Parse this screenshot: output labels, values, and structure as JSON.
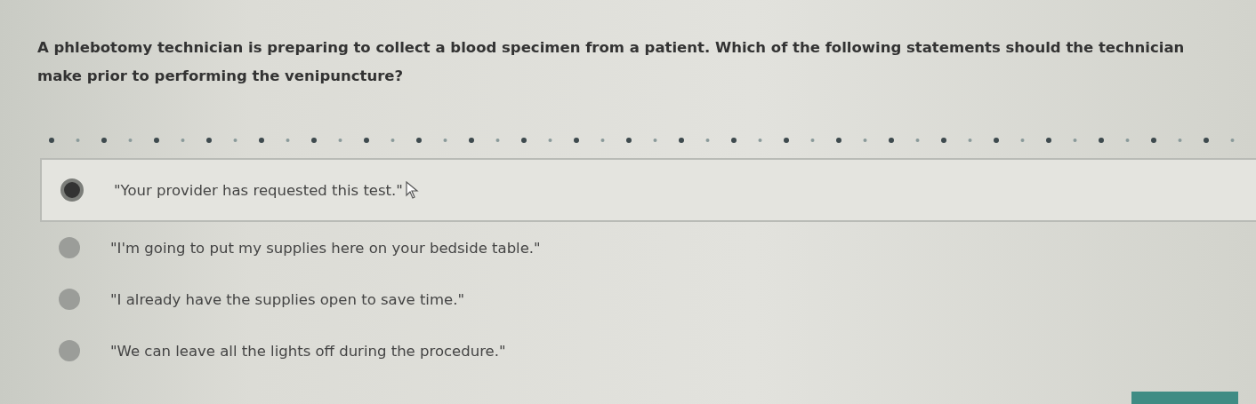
{
  "question": "A phlebotomy technician is preparing to collect a blood specimen from a patient. Which of the following statements should the technician make prior to performing the venipuncture?",
  "options": [
    {
      "label": "\"Your provider has requested this test.\"",
      "selected": true
    },
    {
      "label": "\"I'm going to put my supplies here on your bedside table.\"",
      "selected": false
    },
    {
      "label": "\"I already have the supplies open to save time.\"",
      "selected": false
    },
    {
      "label": "\"We can leave all the lights off during the procedure.\"",
      "selected": false
    }
  ]
}
